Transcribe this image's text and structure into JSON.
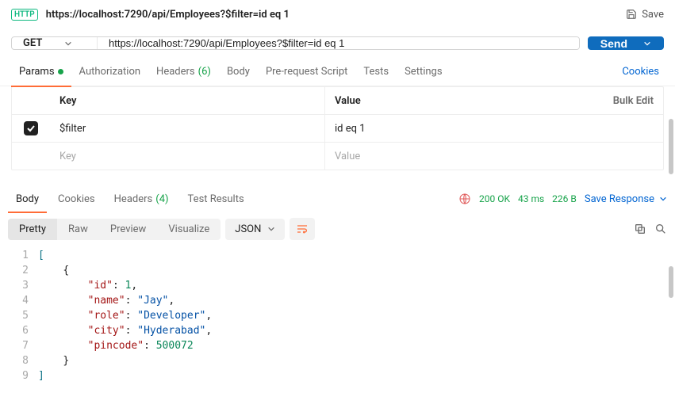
{
  "header": {
    "badge": "HTTP",
    "title": "https://localhost:7290/api/Employees?$filter=id eq 1",
    "save_label": "Save"
  },
  "request": {
    "method": "GET",
    "url": "https://localhost:7290/api/Employees?$filter=id eq 1",
    "send_label": "Send"
  },
  "tabs": {
    "params": "Params",
    "authorization": "Authorization",
    "headers": "Headers",
    "headers_count": "(6)",
    "body": "Body",
    "prerequest": "Pre-request Script",
    "tests": "Tests",
    "settings": "Settings",
    "cookies": "Cookies"
  },
  "params_table": {
    "key_header": "Key",
    "value_header": "Value",
    "bulk_edit": "Bulk Edit",
    "rows": [
      {
        "key": "$filter",
        "value": "id eq 1",
        "checked": true
      }
    ],
    "placeholder_key": "Key",
    "placeholder_value": "Value"
  },
  "response_tabs": {
    "body": "Body",
    "cookies": "Cookies",
    "headers": "Headers",
    "headers_count": "(4)",
    "test_results": "Test Results"
  },
  "status": {
    "code": "200 OK",
    "time": "43 ms",
    "size": "226 B",
    "save_response": "Save Response"
  },
  "view": {
    "pretty": "Pretty",
    "raw": "Raw",
    "preview": "Preview",
    "visualize": "Visualize",
    "format": "JSON"
  },
  "response_body": {
    "id": 1,
    "name": "Jay",
    "role": "Developer",
    "city": "Hyderabad",
    "pincode": 500072
  },
  "code_lines": [
    "1",
    "2",
    "3",
    "4",
    "5",
    "6",
    "7",
    "8",
    "9"
  ]
}
